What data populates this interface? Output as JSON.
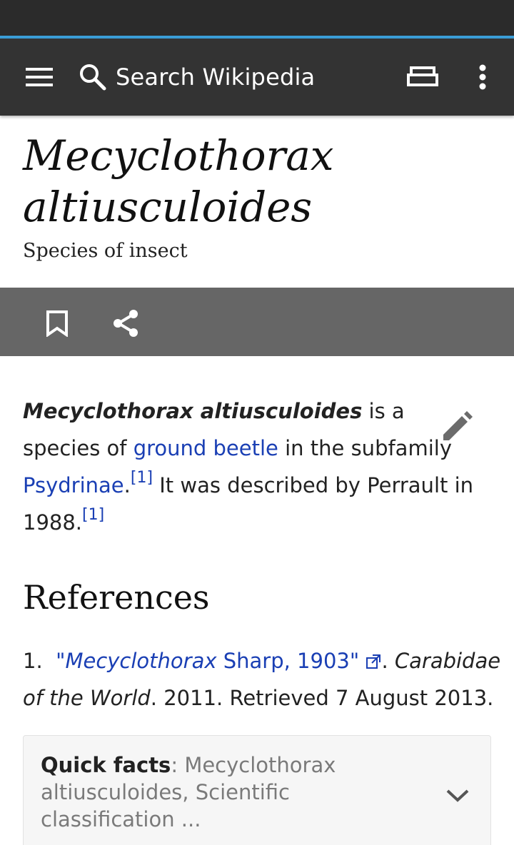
{
  "toolbar": {
    "search_placeholder": "Search Wikipedia",
    "menu_icon": "hamburger-menu-icon",
    "reading_list_icon": "reading-list-icon",
    "overflow_icon": "more-vert-icon"
  },
  "article": {
    "title_line1": "Mecyclothorax",
    "title_line2": "altiusculoides",
    "description": "Species of insect"
  },
  "actions": {
    "bookmark_icon": "bookmark-icon",
    "share_icon": "share-icon"
  },
  "lead": {
    "bold_name": "Mecyclothorax altiusculoides",
    "text1": " is a species of ",
    "link1": "ground beetle",
    "text2": " in the subfamily ",
    "link2": "Psydrinae",
    "text3": ".",
    "cite1": "[1]",
    "text4": " It was described by Perrault in 1988.",
    "cite2": "[1]"
  },
  "references": {
    "heading": "References",
    "items": [
      {
        "number": "1.",
        "quote_open": "\"",
        "link_italic": "Mecyclothorax",
        "link_rest": " Sharp, 1903",
        "quote_close": "\"",
        "after_link": ". ",
        "source_italic": "Carabidae of the World",
        "tail": ". 2011. Retrieved 7 August 2013."
      }
    ]
  },
  "quick_facts": {
    "label": "Quick facts",
    "separator": ": ",
    "summary": "Mecyclothorax altiusculoides, Scientific classification ..."
  },
  "colors": {
    "toolbar": "#333333",
    "status_bar": "#2b2b2b",
    "progress": "#3b9ed8",
    "action_bar": "#666666",
    "link": "#1a3fb4"
  }
}
